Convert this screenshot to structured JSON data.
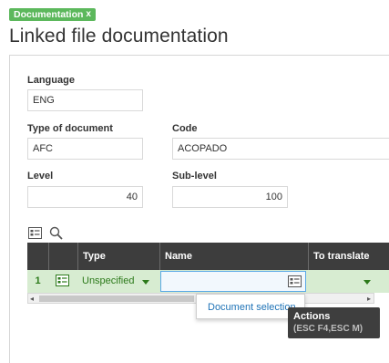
{
  "tag": {
    "label": "Documentation",
    "close": "x"
  },
  "title": "Linked file documentation",
  "fields": {
    "language": {
      "label": "Language",
      "value": "ENG"
    },
    "type_of_document": {
      "label": "Type of document",
      "value": "AFC"
    },
    "code": {
      "label": "Code",
      "value": "ACOPADO"
    },
    "level": {
      "label": "Level",
      "value": "40"
    },
    "sub_level": {
      "label": "Sub-level",
      "value": "100"
    }
  },
  "grid": {
    "columns": [
      "Type",
      "Name",
      "To translate"
    ],
    "rows": [
      {
        "num": "1",
        "type": "Unspecified",
        "name": "",
        "to_translate": ""
      }
    ]
  },
  "dropdown": {
    "item": "Document selection"
  },
  "tooltip": {
    "title": "Actions",
    "shortcut": "(ESC F4,ESC M)"
  },
  "colors": {
    "accent_green": "#5cb85c",
    "grid_header": "#3d3d3d",
    "row_selected": "#d7ecd1",
    "link_blue": "#1f73b7"
  }
}
